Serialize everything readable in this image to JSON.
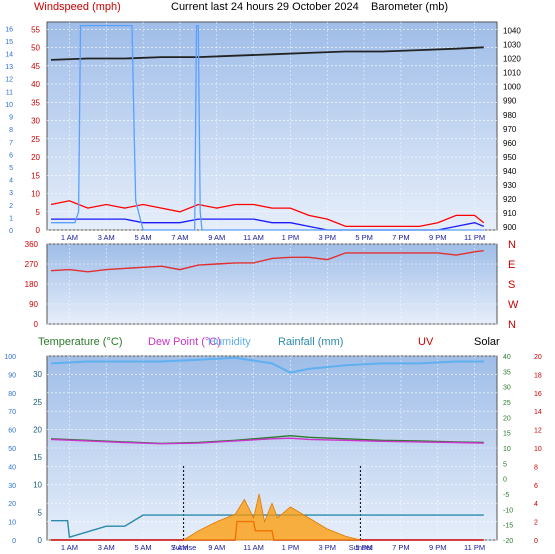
{
  "header": {
    "windspeed_label": "Windspeed (mph)",
    "title": "Current last 24 hours 29 October 2024",
    "barometer_label": "Barometer (mb)"
  },
  "colors": {
    "plot_bg_top": "#9fbde8",
    "plot_bg_bottom": "#e6eefa",
    "wind_gust": "#ff0000",
    "wind_avg": "#1a1aff",
    "wind_beaufort": "#5aa0ff",
    "barometer": "#222222",
    "direction": "#e03030",
    "temperature": "#2d7a2d",
    "dewpoint": "#cc33cc",
    "humidity": "#5fb0f0",
    "rainfall": "#2a8aaa",
    "uv": "#cc0000",
    "solar": "#ff9900",
    "axis_left": "#2a6fd6",
    "axis_red": "#cc0000",
    "axis_green": "#2d7a2d"
  },
  "time_ticks": [
    "1 AM",
    "3 AM",
    "5 AM",
    "7 AM",
    "9 AM",
    "11 AM",
    "1 PM",
    "3 PM",
    "5 PM",
    "7 PM",
    "9 PM",
    "11 PM"
  ],
  "chart_data": [
    {
      "id": "wind",
      "type": "line",
      "x_unit": "hour",
      "y_left_beaufort": [
        0,
        1,
        2,
        3,
        4,
        5,
        6,
        7,
        8,
        9,
        10,
        11,
        12,
        13,
        14,
        15,
        16
      ],
      "y_left_mph": [
        0,
        5,
        10,
        15,
        20,
        25,
        30,
        35,
        40,
        45,
        50,
        55
      ],
      "y_right_mb": [
        900,
        910,
        920,
        930,
        940,
        950,
        960,
        970,
        980,
        990,
        1000,
        1010,
        1020,
        1030,
        1040
      ],
      "ylim_mph": [
        0,
        57
      ],
      "ylim_mb": [
        898,
        1046
      ],
      "series": [
        {
          "key": "barometer",
          "axis": "mb",
          "x": [
            0,
            2,
            4,
            6,
            8,
            10,
            12,
            14,
            16,
            18,
            20,
            22,
            23.5
          ],
          "y": [
            1019,
            1020,
            1020,
            1021,
            1021,
            1022,
            1023,
            1024,
            1025,
            1025,
            1026,
            1027,
            1028
          ]
        },
        {
          "key": "gust",
          "axis": "mph",
          "x": [
            0,
            1,
            2,
            3,
            4,
            5,
            6,
            7,
            8,
            9,
            10,
            11,
            12,
            13,
            14,
            15,
            16,
            17,
            18,
            19,
            20,
            21,
            22,
            23,
            23.5
          ],
          "y": [
            7,
            8,
            6,
            7,
            6,
            7,
            6,
            5,
            7,
            6,
            7,
            7,
            6,
            6,
            4,
            3,
            1,
            1,
            1,
            1,
            1,
            2,
            4,
            4,
            2
          ]
        },
        {
          "key": "avg",
          "axis": "mph",
          "x": [
            0,
            1,
            2,
            3,
            4,
            5,
            6,
            7,
            8,
            9,
            10,
            11,
            12,
            13,
            14,
            15,
            16,
            17,
            18,
            19,
            20,
            21,
            22,
            23,
            23.5
          ],
          "y": [
            3,
            3,
            3,
            3,
            3,
            2,
            2,
            2,
            3,
            3,
            3,
            3,
            2,
            2,
            1,
            0,
            0,
            0,
            0,
            0,
            0,
            0,
            1,
            2,
            1
          ]
        },
        {
          "key": "beaufort",
          "axis": "mph",
          "x": [
            0,
            1.3,
            1.5,
            1.6,
            4.4,
            4.5,
            4.6,
            5.0,
            7.8,
            7.9,
            8.0,
            8.1,
            8.2,
            23.5
          ],
          "y": [
            2,
            2,
            5,
            56,
            56,
            30,
            8,
            0,
            0,
            56,
            56,
            5,
            0,
            0
          ]
        }
      ]
    },
    {
      "id": "direction",
      "type": "line",
      "y_ticks": [
        0,
        90,
        180,
        270,
        360
      ],
      "y_labels_right": [
        "N",
        "W",
        "S",
        "E",
        "N"
      ],
      "ylim": [
        0,
        360
      ],
      "series": [
        {
          "key": "direction",
          "x": [
            0,
            1,
            2,
            3,
            4,
            5,
            6,
            7,
            8,
            9,
            10,
            11,
            12,
            13,
            14,
            15,
            16,
            17,
            18,
            19,
            20,
            21,
            22,
            23,
            23.5
          ],
          "y": [
            240,
            245,
            235,
            245,
            250,
            255,
            260,
            245,
            265,
            270,
            275,
            275,
            295,
            300,
            300,
            290,
            320,
            320,
            320,
            320,
            320,
            320,
            310,
            325,
            330
          ]
        }
      ]
    },
    {
      "id": "conditions",
      "type": "line",
      "legend": [
        "Temperature (°C)",
        "Dew Point (°C)",
        "Humidity",
        "Rainfall (mm)",
        "UV",
        "Solar"
      ],
      "y_left_humidity": [
        0,
        10,
        20,
        30,
        40,
        50,
        60,
        70,
        80,
        90,
        100
      ],
      "y_left_rain": [
        0,
        5,
        10,
        15,
        20,
        25,
        30
      ],
      "y_right_temp": [
        -20,
        -15,
        -10,
        -5,
        0,
        5,
        10,
        15,
        20,
        25,
        30,
        35,
        40
      ],
      "y_right_uv": [
        0,
        2,
        4,
        6,
        8,
        10,
        12,
        14,
        16,
        18,
        20
      ],
      "sunrise_label": "Sunrise",
      "sunset_label": "Sunset",
      "sunrise_x": 7.2,
      "sunset_x": 16.8,
      "series": [
        {
          "key": "humidity",
          "axis": "humidity",
          "x": [
            0,
            2,
            4,
            6,
            8,
            10,
            12,
            13,
            14,
            16,
            18,
            20,
            22,
            23.5
          ],
          "y": [
            96,
            97,
            97,
            97,
            98,
            99,
            96,
            91,
            93,
            95,
            96,
            96,
            97,
            97
          ]
        },
        {
          "key": "temperature",
          "axis": "temp",
          "x": [
            0,
            2,
            4,
            6,
            8,
            10,
            12,
            13,
            14,
            16,
            18,
            20,
            22,
            23.5
          ],
          "y": [
            13,
            12.5,
            12,
            11.5,
            11.8,
            12.5,
            13.5,
            14,
            13.5,
            13,
            12.5,
            12.3,
            12,
            11.8
          ]
        },
        {
          "key": "dewpoint",
          "axis": "temp",
          "x": [
            0,
            2,
            4,
            6,
            8,
            10,
            12,
            13,
            14,
            16,
            18,
            20,
            22,
            23.5
          ],
          "y": [
            12.8,
            12.3,
            11.8,
            11.4,
            11.6,
            12.3,
            13,
            13.2,
            12.8,
            12.5,
            12.2,
            12,
            11.8,
            11.6
          ]
        },
        {
          "key": "rainfall",
          "axis": "rain",
          "x": [
            0,
            0.9,
            1,
            3,
            4,
            5,
            23.5
          ],
          "y": [
            3.5,
            3.5,
            0.5,
            2.5,
            2.5,
            4.5,
            4.5
          ]
        },
        {
          "key": "uv",
          "axis": "uv",
          "x": [
            0,
            10,
            10.1,
            11,
            11.1,
            12,
            12.1,
            23.5
          ],
          "y": [
            0,
            0,
            2,
            2,
            1,
            1,
            0,
            0
          ]
        },
        {
          "key": "solar",
          "axis": "humidity",
          "x": [
            7.2,
            8,
            9,
            10,
            10.5,
            11,
            11.3,
            11.6,
            12,
            12.3,
            13,
            14,
            15,
            16,
            16.8
          ],
          "y": [
            0,
            5,
            10,
            14,
            22,
            12,
            25,
            10,
            20,
            12,
            18,
            12,
            6,
            2,
            0
          ]
        }
      ]
    }
  ]
}
